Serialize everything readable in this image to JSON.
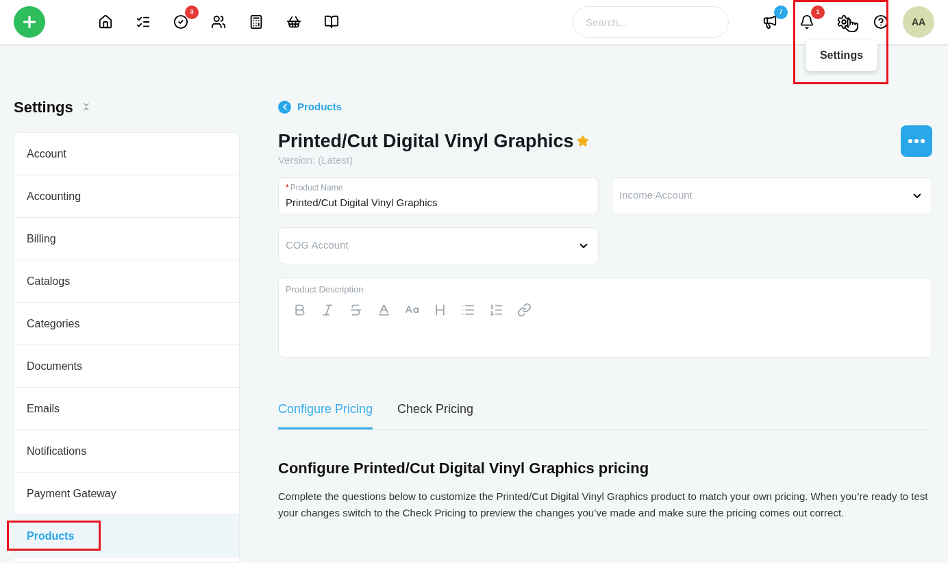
{
  "top_bar": {
    "task_badge": "3",
    "search": {
      "placeholder": "Search..."
    },
    "announcements_badge": "7",
    "notifications_badge": "1",
    "settings_tooltip": {
      "label": "Settings",
      "highlighted": true
    },
    "avatar": "AA"
  },
  "sidebar": {
    "title": "Settings",
    "items": [
      {
        "label": "Account",
        "selected": false,
        "highlighted": false
      },
      {
        "label": "Accounting",
        "selected": false,
        "highlighted": false
      },
      {
        "label": "Billing",
        "selected": false,
        "highlighted": false
      },
      {
        "label": "Catalogs",
        "selected": false,
        "highlighted": false
      },
      {
        "label": "Categories",
        "selected": false,
        "highlighted": false
      },
      {
        "label": "Documents",
        "selected": false,
        "highlighted": false
      },
      {
        "label": "Emails",
        "selected": false,
        "highlighted": false
      },
      {
        "label": "Notifications",
        "selected": false,
        "highlighted": false
      },
      {
        "label": "Payment Gateway",
        "selected": false,
        "highlighted": false
      },
      {
        "label": "Products",
        "selected": true,
        "highlighted": true
      }
    ]
  },
  "main": {
    "breadcrumb": "Products",
    "title": "Printed/Cut Digital Vinyl Graphics",
    "starred": true,
    "version": "Version: (Latest)",
    "fields": [
      {
        "kind": "text",
        "required_mark": "*",
        "label": "Product Name",
        "value": "Printed/Cut Digital Vinyl Graphics"
      },
      {
        "kind": "select",
        "placeholder": "Income Account"
      },
      {
        "kind": "select",
        "placeholder": "COG Account"
      }
    ],
    "description": {
      "label": "Product Description"
    },
    "tabs": [
      {
        "label": "Configure Pricing",
        "selected": true
      },
      {
        "label": "Check Pricing",
        "selected": false
      }
    ],
    "section_heading": "Configure Printed/Cut Digital Vinyl Graphics pricing",
    "section_text": "Complete the questions below to customize the Printed/Cut Digital Vinyl Graphics product to match your own pricing. When you’re ready to test your changes switch to the Check Pricing to preview the changes you’ve made and make sure the pricing comes out correct."
  }
}
